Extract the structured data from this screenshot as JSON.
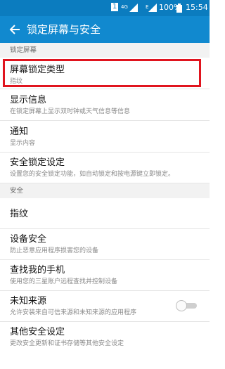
{
  "status_bar": {
    "sim": "1",
    "network": "4G",
    "network_sub": "E",
    "battery": "100%",
    "time": "15:54"
  },
  "appbar": {
    "title": "锁定屏幕与安全"
  },
  "sections": [
    {
      "header": "锁定屏幕",
      "items": [
        {
          "title": "屏幕锁定类型",
          "subtitle": "指纹"
        },
        {
          "title": "显示信息",
          "subtitle": "在锁定屏幕上显示双时钟或天气信息等信息"
        },
        {
          "title": "通知",
          "subtitle": "显示内容"
        },
        {
          "title": "安全锁定设定",
          "subtitle": "设置您的安全锁定功能，如自动锁定和按电源键立即锁定。"
        }
      ]
    },
    {
      "header": "安全",
      "items": [
        {
          "title": "指纹"
        },
        {
          "title": "设备安全",
          "subtitle": "防止恶意应用程序损害您的设备"
        },
        {
          "title": "查找我的手机",
          "subtitle": "使用您的三星账户远程查找并控制设备"
        },
        {
          "title": "未知来源",
          "subtitle": "允许安装来自可信来源和未知来源的应用程序",
          "toggle_on": false
        },
        {
          "title": "其他安全设定",
          "subtitle": "更改安全更新和证书存储等其他安全设定"
        }
      ]
    }
  ],
  "colors": {
    "status_bar": "#0b7cbf",
    "appbar": "#1189cf",
    "highlight": "#e0141e"
  }
}
